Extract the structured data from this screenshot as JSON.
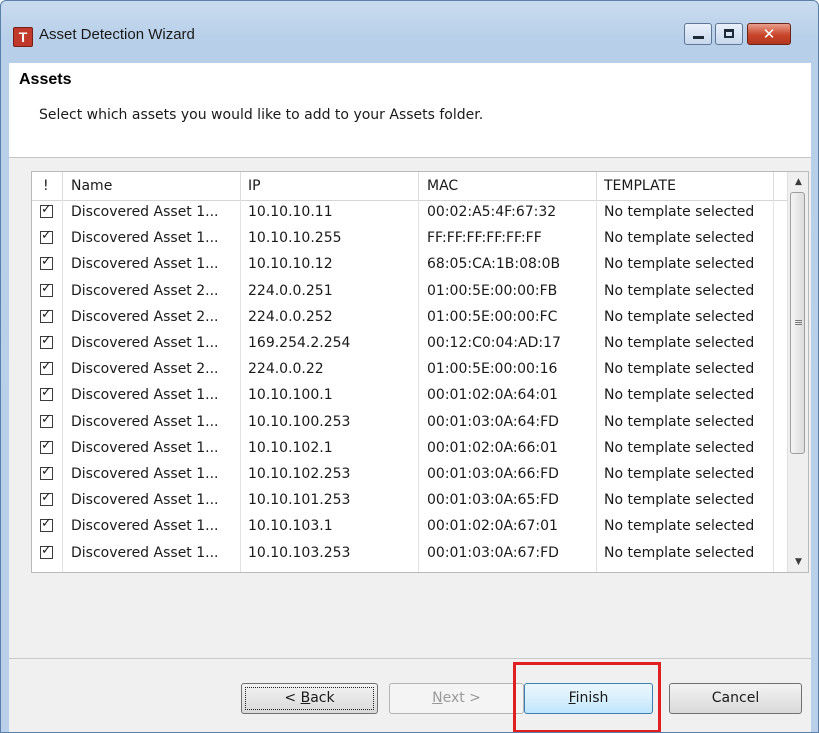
{
  "window": {
    "title": "Asset Detection Wizard",
    "app_icon_letter": "T"
  },
  "header": {
    "title": "Assets",
    "description": "Select which assets you would like to add to your Assets folder."
  },
  "table": {
    "columns": [
      "!",
      "Name",
      "IP",
      "MAC",
      "TEMPLATE"
    ],
    "rows": [
      {
        "checked": true,
        "name": "Discovered Asset 1...",
        "ip": "10.10.10.11",
        "mac": "00:02:A5:4F:67:32",
        "template": "No template selected"
      },
      {
        "checked": true,
        "name": "Discovered Asset 1...",
        "ip": "10.10.10.255",
        "mac": "FF:FF:FF:FF:FF:FF",
        "template": "No template selected"
      },
      {
        "checked": true,
        "name": "Discovered Asset 1...",
        "ip": "10.10.10.12",
        "mac": "68:05:CA:1B:08:0B",
        "template": "No template selected"
      },
      {
        "checked": true,
        "name": "Discovered Asset 2...",
        "ip": "224.0.0.251",
        "mac": "01:00:5E:00:00:FB",
        "template": "No template selected"
      },
      {
        "checked": true,
        "name": "Discovered Asset 2...",
        "ip": "224.0.0.252",
        "mac": "01:00:5E:00:00:FC",
        "template": "No template selected"
      },
      {
        "checked": true,
        "name": "Discovered Asset 1...",
        "ip": "169.254.2.254",
        "mac": "00:12:C0:04:AD:17",
        "template": "No template selected"
      },
      {
        "checked": true,
        "name": "Discovered Asset 2...",
        "ip": "224.0.0.22",
        "mac": "01:00:5E:00:00:16",
        "template": "No template selected"
      },
      {
        "checked": true,
        "name": "Discovered Asset 1...",
        "ip": "10.10.100.1",
        "mac": "00:01:02:0A:64:01",
        "template": "No template selected"
      },
      {
        "checked": true,
        "name": "Discovered Asset 1...",
        "ip": "10.10.100.253",
        "mac": "00:01:03:0A:64:FD",
        "template": "No template selected"
      },
      {
        "checked": true,
        "name": "Discovered Asset 1...",
        "ip": "10.10.102.1",
        "mac": "00:01:02:0A:66:01",
        "template": "No template selected"
      },
      {
        "checked": true,
        "name": "Discovered Asset 1...",
        "ip": "10.10.102.253",
        "mac": "00:01:03:0A:66:FD",
        "template": "No template selected"
      },
      {
        "checked": true,
        "name": "Discovered Asset 1...",
        "ip": "10.10.101.253",
        "mac": "00:01:03:0A:65:FD",
        "template": "No template selected"
      },
      {
        "checked": true,
        "name": "Discovered Asset 1...",
        "ip": "10.10.103.1",
        "mac": "00:01:02:0A:67:01",
        "template": "No template selected"
      },
      {
        "checked": true,
        "name": "Discovered Asset 1...",
        "ip": "10.10.103.253",
        "mac": "00:01:03:0A:67:FD",
        "template": "No template selected"
      }
    ]
  },
  "buttons": {
    "back": {
      "prefix": "< ",
      "mnemonic": "B",
      "rest": "ack"
    },
    "next": {
      "mnemonic": "N",
      "rest": "ext >"
    },
    "finish": {
      "mnemonic": "F",
      "rest": "inish"
    },
    "cancel": {
      "label": "Cancel"
    }
  },
  "icons": {
    "minimize": "minimize-icon",
    "maximize": "maximize-icon",
    "close": "close-icon",
    "scroll_up": "scroll-up-arrow-icon",
    "scroll_down": "scroll-down-arrow-icon",
    "checkbox": "checkbox-checked-icon"
  },
  "colors": {
    "highlight": "#e02020",
    "finish_button": "#bee6fd",
    "title_bar": "#b7cfe9"
  }
}
